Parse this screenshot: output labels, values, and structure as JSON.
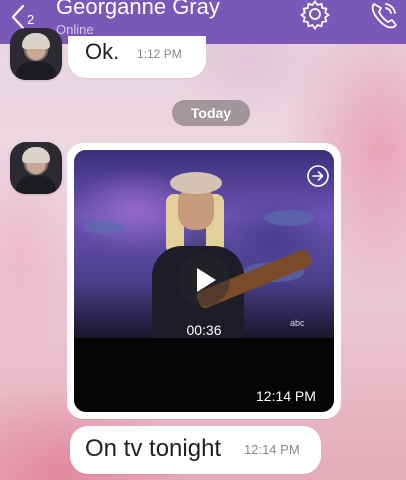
{
  "header": {
    "back_count": "2",
    "contact_name": "Georganne Gray",
    "status": "Online",
    "icons": [
      "chevron-left-icon",
      "gear-icon",
      "phone-icon"
    ]
  },
  "messages": [
    {
      "text": "Ok.",
      "time": "1:12 PM"
    },
    {
      "type": "video",
      "duration": "00:36",
      "time": "12:14 PM",
      "watermark": "abc"
    },
    {
      "text": "On tv tonight",
      "time": "12:14 PM"
    }
  ],
  "date_separator": "Today",
  "colors": {
    "header_bg": "#7a58b8",
    "bubble_bg": "#ffffff",
    "pill_bg": "#8a7f84"
  }
}
